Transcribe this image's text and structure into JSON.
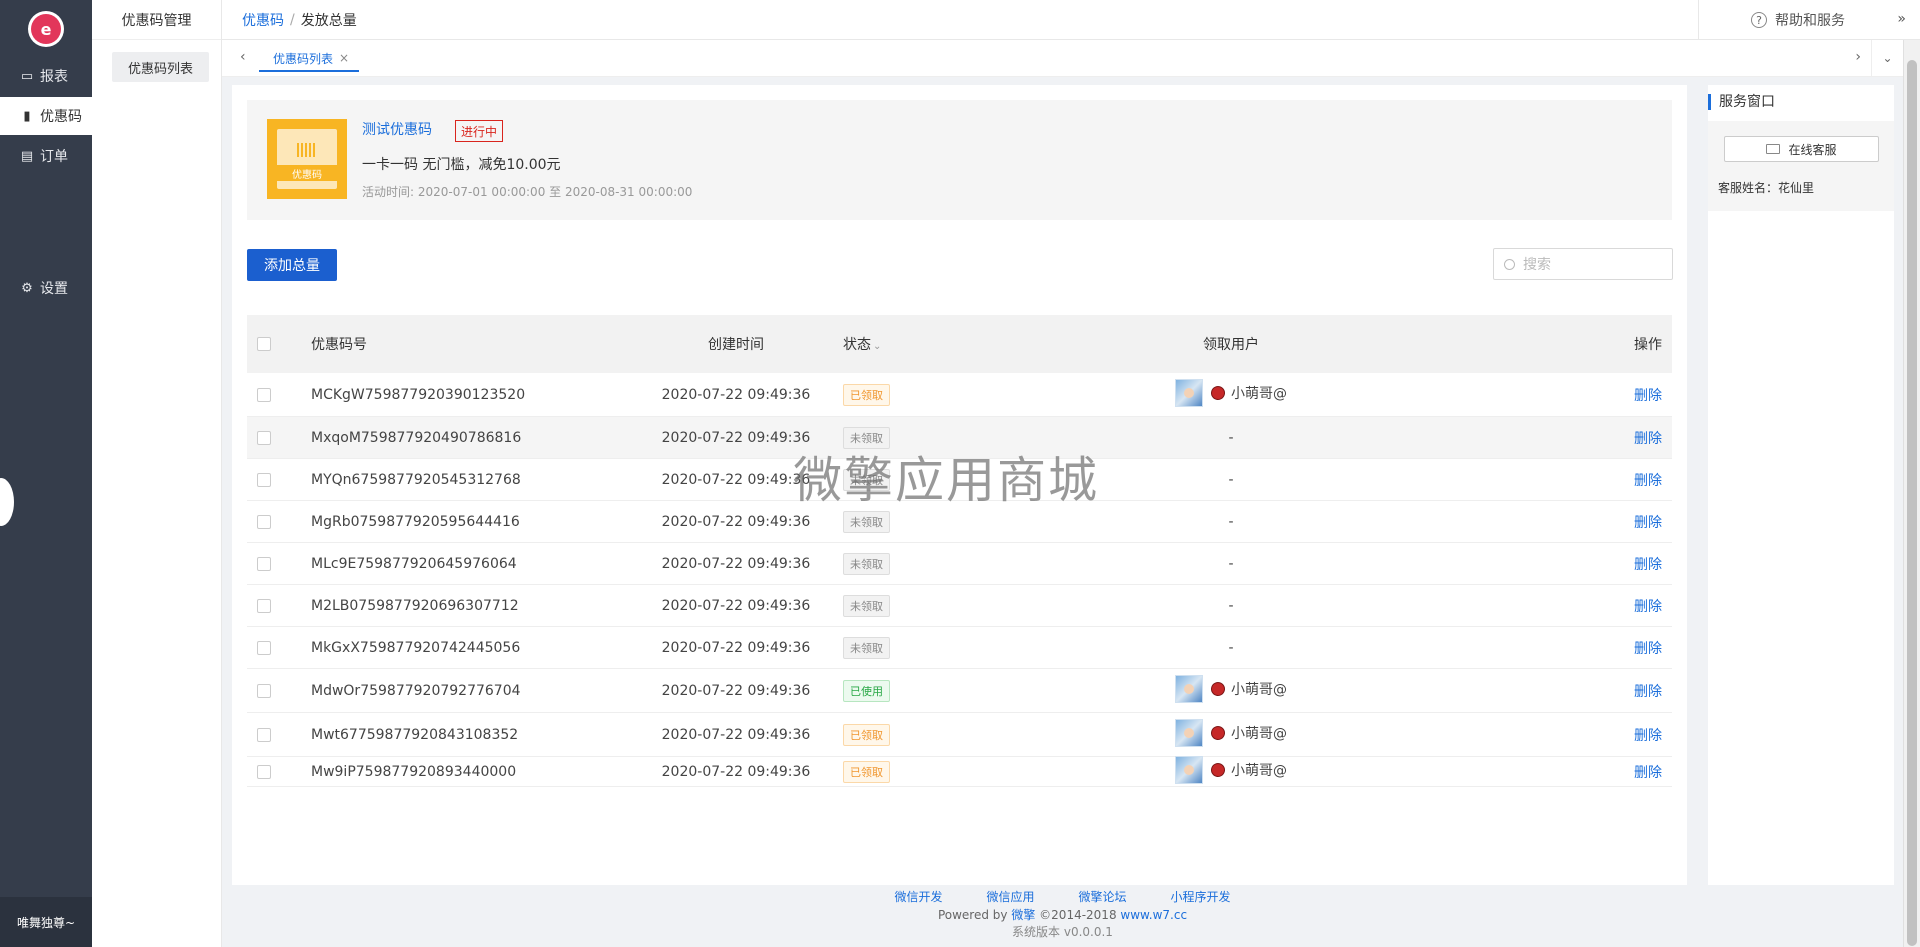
{
  "nav": {
    "logo_glyph": "e",
    "items": [
      {
        "label": "报表",
        "icon": "report-icon"
      },
      {
        "label": "优惠码",
        "icon": "bar-chart-icon"
      },
      {
        "label": "订单",
        "icon": "order-icon"
      },
      {
        "label": "设置",
        "icon": "gear-icon"
      }
    ],
    "user": "唯舞独尊~"
  },
  "subnav": {
    "title": "优惠码管理",
    "items": [
      "优惠码列表"
    ]
  },
  "topbar": {
    "breadcrumb": [
      "优惠码",
      "发放总量"
    ],
    "help": "帮助和服务"
  },
  "tabs": [
    {
      "label": "优惠码列表"
    }
  ],
  "coupon": {
    "thumb_label": "优惠码",
    "title": "测试优惠码",
    "status": "进行中",
    "desc": "一卡一码 无门槛，减免10.00元",
    "time_label": "活动时间:",
    "time_range": "2020-07-01 00:00:00 至 2020-08-31 00:00:00"
  },
  "toolbar": {
    "add_label": "添加总量",
    "search_placeholder": "搜索"
  },
  "table": {
    "headers": {
      "code": "优惠码号",
      "time": "创建时间",
      "status": "状态",
      "user": "领取用户",
      "op": "操作"
    },
    "rows": [
      {
        "code": "MCKgW759877920390123520",
        "time": "2020-07-22 09:49:36",
        "status": "已领取",
        "kind": "received",
        "user": "小萌哥@",
        "op": "删除"
      },
      {
        "code": "MxqoM759877920490786816",
        "time": "2020-07-22 09:49:36",
        "status": "未领取",
        "kind": "unreceived",
        "user": "-",
        "op": "删除"
      },
      {
        "code": "MYQn6759877920545312768",
        "time": "2020-07-22 09:49:36",
        "status": "未领取",
        "kind": "unreceived",
        "user": "-",
        "op": "删除"
      },
      {
        "code": "MgRb0759877920595644416",
        "time": "2020-07-22 09:49:36",
        "status": "未领取",
        "kind": "unreceived",
        "user": "-",
        "op": "删除"
      },
      {
        "code": "MLc9E759877920645976064",
        "time": "2020-07-22 09:49:36",
        "status": "未领取",
        "kind": "unreceived",
        "user": "-",
        "op": "删除"
      },
      {
        "code": "M2LB0759877920696307712",
        "time": "2020-07-22 09:49:36",
        "status": "未领取",
        "kind": "unreceived",
        "user": "-",
        "op": "删除"
      },
      {
        "code": "MkGxX759877920742445056",
        "time": "2020-07-22 09:49:36",
        "status": "未领取",
        "kind": "unreceived",
        "user": "-",
        "op": "删除"
      },
      {
        "code": "MdwOr759877920792776704",
        "time": "2020-07-22 09:49:36",
        "status": "已使用",
        "kind": "used",
        "user": "小萌哥@",
        "op": "删除"
      },
      {
        "code": "Mwt67759877920843108352",
        "time": "2020-07-22 09:49:36",
        "status": "已领取",
        "kind": "received",
        "user": "小萌哥@",
        "op": "删除"
      },
      {
        "code": "Mw9iP759877920893440000",
        "time": "2020-07-22 09:49:36",
        "status": "已领取",
        "kind": "received",
        "user": "小萌哥@",
        "op": "删除"
      }
    ]
  },
  "watermark": "微擎应用商城",
  "service": {
    "title": "服务窗口",
    "button": "在线客服",
    "name": "客服姓名：花仙里"
  },
  "footer": {
    "links": [
      "微信开发",
      "微信应用",
      "微擎论坛",
      "小程序开发"
    ],
    "powered_prefix": "Powered by",
    "powered_brand": "微擎",
    "copyright": "©2014-2018",
    "site": "www.w7.cc",
    "version": "系统版本 v0.0.0.1"
  },
  "colors": {
    "primary": "#1b6edb",
    "nav_bg": "#353d4b",
    "status_active": "#d9251d"
  }
}
